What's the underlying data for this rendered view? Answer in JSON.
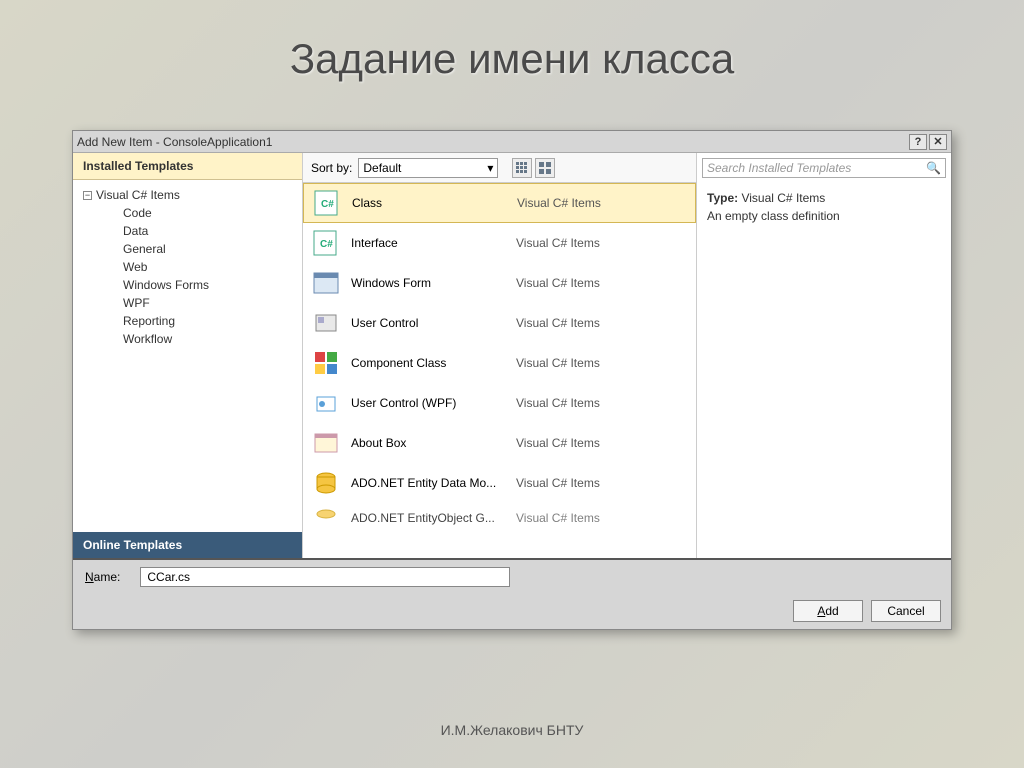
{
  "slide_title": "Задание имени класса",
  "footer": "И.М.Желакович БНТУ",
  "dialog": {
    "title": "Add New Item - ConsoleApplication1",
    "help": "?",
    "close": "✕",
    "sidebar": {
      "installed_header": "Installed Templates",
      "root": "Visual C# Items",
      "children": [
        "Code",
        "Data",
        "General",
        "Web",
        "Windows Forms",
        "WPF",
        "Reporting",
        "Workflow"
      ],
      "online": "Online Templates"
    },
    "sortbar": {
      "label": "Sort by:",
      "value": "Default"
    },
    "search_placeholder": "Search Installed Templates",
    "desc": {
      "type_label": "Type:",
      "type_value": "Visual C# Items",
      "summary": "An empty class definition"
    },
    "items": [
      {
        "name": "Class",
        "cat": "Visual C# Items",
        "icon": "cs"
      },
      {
        "name": "Interface",
        "cat": "Visual C# Items",
        "icon": "cs"
      },
      {
        "name": "Windows Form",
        "cat": "Visual C# Items",
        "icon": "form"
      },
      {
        "name": "User Control",
        "cat": "Visual C# Items",
        "icon": "uc"
      },
      {
        "name": "Component Class",
        "cat": "Visual C# Items",
        "icon": "comp"
      },
      {
        "name": "User Control (WPF)",
        "cat": "Visual C# Items",
        "icon": "wpf"
      },
      {
        "name": "About Box",
        "cat": "Visual C# Items",
        "icon": "about"
      },
      {
        "name": "ADO.NET Entity Data Mo...",
        "cat": "Visual C# Items",
        "icon": "db"
      },
      {
        "name": "ADO.NET EntityObject G...",
        "cat": "Visual C# Items",
        "icon": "db"
      }
    ],
    "name_label": "Name:",
    "name_value": "CCar.cs",
    "add_btn": "Add",
    "cancel_btn": "Cancel"
  }
}
